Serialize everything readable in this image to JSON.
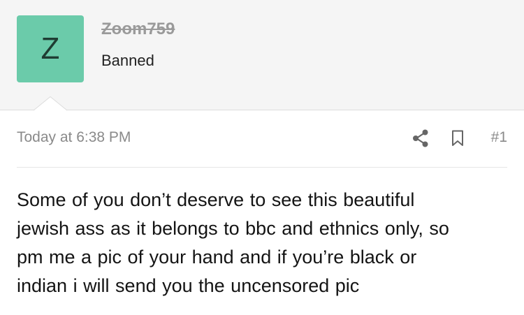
{
  "post": {
    "author": {
      "avatar_letter": "Z",
      "avatar_color": "#6bcbaa",
      "username": "Zoom759",
      "user_title": "Banned"
    },
    "timestamp": "Today at 6:38 PM",
    "post_number": "#1",
    "body_lines": [
      "Some of you don’t deserve to see this beautiful",
      "jewish ass as it belongs to bbc and ethnics only, so",
      "pm me a pic of your hand and if you’re black or",
      "indian i will send you the uncensored pic"
    ]
  },
  "icons": {
    "share": "share-icon",
    "bookmark": "bookmark-icon"
  }
}
